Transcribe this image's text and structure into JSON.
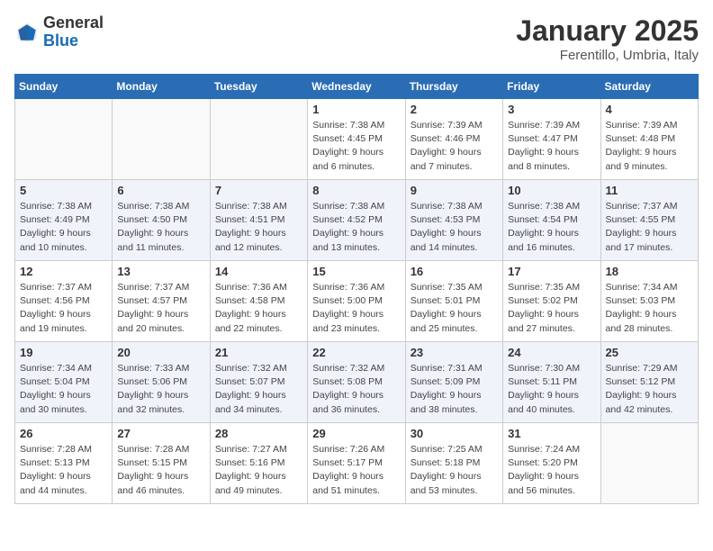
{
  "header": {
    "logo_general": "General",
    "logo_blue": "Blue",
    "month_year": "January 2025",
    "location": "Ferentillo, Umbria, Italy"
  },
  "days_of_week": [
    "Sunday",
    "Monday",
    "Tuesday",
    "Wednesday",
    "Thursday",
    "Friday",
    "Saturday"
  ],
  "weeks": [
    {
      "days": [
        {
          "day": "",
          "info": ""
        },
        {
          "day": "",
          "info": ""
        },
        {
          "day": "",
          "info": ""
        },
        {
          "day": "1",
          "info": "Sunrise: 7:38 AM\nSunset: 4:45 PM\nDaylight: 9 hours and 6 minutes."
        },
        {
          "day": "2",
          "info": "Sunrise: 7:39 AM\nSunset: 4:46 PM\nDaylight: 9 hours and 7 minutes."
        },
        {
          "day": "3",
          "info": "Sunrise: 7:39 AM\nSunset: 4:47 PM\nDaylight: 9 hours and 8 minutes."
        },
        {
          "day": "4",
          "info": "Sunrise: 7:39 AM\nSunset: 4:48 PM\nDaylight: 9 hours and 9 minutes."
        }
      ]
    },
    {
      "days": [
        {
          "day": "5",
          "info": "Sunrise: 7:38 AM\nSunset: 4:49 PM\nDaylight: 9 hours and 10 minutes."
        },
        {
          "day": "6",
          "info": "Sunrise: 7:38 AM\nSunset: 4:50 PM\nDaylight: 9 hours and 11 minutes."
        },
        {
          "day": "7",
          "info": "Sunrise: 7:38 AM\nSunset: 4:51 PM\nDaylight: 9 hours and 12 minutes."
        },
        {
          "day": "8",
          "info": "Sunrise: 7:38 AM\nSunset: 4:52 PM\nDaylight: 9 hours and 13 minutes."
        },
        {
          "day": "9",
          "info": "Sunrise: 7:38 AM\nSunset: 4:53 PM\nDaylight: 9 hours and 14 minutes."
        },
        {
          "day": "10",
          "info": "Sunrise: 7:38 AM\nSunset: 4:54 PM\nDaylight: 9 hours and 16 minutes."
        },
        {
          "day": "11",
          "info": "Sunrise: 7:37 AM\nSunset: 4:55 PM\nDaylight: 9 hours and 17 minutes."
        }
      ]
    },
    {
      "days": [
        {
          "day": "12",
          "info": "Sunrise: 7:37 AM\nSunset: 4:56 PM\nDaylight: 9 hours and 19 minutes."
        },
        {
          "day": "13",
          "info": "Sunrise: 7:37 AM\nSunset: 4:57 PM\nDaylight: 9 hours and 20 minutes."
        },
        {
          "day": "14",
          "info": "Sunrise: 7:36 AM\nSunset: 4:58 PM\nDaylight: 9 hours and 22 minutes."
        },
        {
          "day": "15",
          "info": "Sunrise: 7:36 AM\nSunset: 5:00 PM\nDaylight: 9 hours and 23 minutes."
        },
        {
          "day": "16",
          "info": "Sunrise: 7:35 AM\nSunset: 5:01 PM\nDaylight: 9 hours and 25 minutes."
        },
        {
          "day": "17",
          "info": "Sunrise: 7:35 AM\nSunset: 5:02 PM\nDaylight: 9 hours and 27 minutes."
        },
        {
          "day": "18",
          "info": "Sunrise: 7:34 AM\nSunset: 5:03 PM\nDaylight: 9 hours and 28 minutes."
        }
      ]
    },
    {
      "days": [
        {
          "day": "19",
          "info": "Sunrise: 7:34 AM\nSunset: 5:04 PM\nDaylight: 9 hours and 30 minutes."
        },
        {
          "day": "20",
          "info": "Sunrise: 7:33 AM\nSunset: 5:06 PM\nDaylight: 9 hours and 32 minutes."
        },
        {
          "day": "21",
          "info": "Sunrise: 7:32 AM\nSunset: 5:07 PM\nDaylight: 9 hours and 34 minutes."
        },
        {
          "day": "22",
          "info": "Sunrise: 7:32 AM\nSunset: 5:08 PM\nDaylight: 9 hours and 36 minutes."
        },
        {
          "day": "23",
          "info": "Sunrise: 7:31 AM\nSunset: 5:09 PM\nDaylight: 9 hours and 38 minutes."
        },
        {
          "day": "24",
          "info": "Sunrise: 7:30 AM\nSunset: 5:11 PM\nDaylight: 9 hours and 40 minutes."
        },
        {
          "day": "25",
          "info": "Sunrise: 7:29 AM\nSunset: 5:12 PM\nDaylight: 9 hours and 42 minutes."
        }
      ]
    },
    {
      "days": [
        {
          "day": "26",
          "info": "Sunrise: 7:28 AM\nSunset: 5:13 PM\nDaylight: 9 hours and 44 minutes."
        },
        {
          "day": "27",
          "info": "Sunrise: 7:28 AM\nSunset: 5:15 PM\nDaylight: 9 hours and 46 minutes."
        },
        {
          "day": "28",
          "info": "Sunrise: 7:27 AM\nSunset: 5:16 PM\nDaylight: 9 hours and 49 minutes."
        },
        {
          "day": "29",
          "info": "Sunrise: 7:26 AM\nSunset: 5:17 PM\nDaylight: 9 hours and 51 minutes."
        },
        {
          "day": "30",
          "info": "Sunrise: 7:25 AM\nSunset: 5:18 PM\nDaylight: 9 hours and 53 minutes."
        },
        {
          "day": "31",
          "info": "Sunrise: 7:24 AM\nSunset: 5:20 PM\nDaylight: 9 hours and 56 minutes."
        },
        {
          "day": "",
          "info": ""
        }
      ]
    }
  ]
}
